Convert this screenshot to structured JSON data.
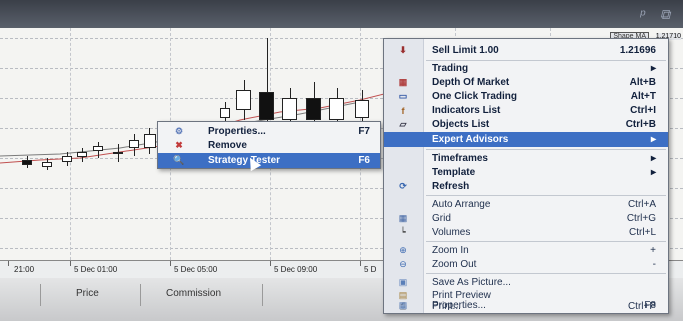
{
  "chart": {
    "ma_label": "Shape MA",
    "price_tag": "1.21710"
  },
  "time_axis": {
    "labels": [
      "21:00",
      "5 Dec 01:00",
      "5 Dec 05:00",
      "5 Dec 09:00",
      "5 D"
    ]
  },
  "terminal": {
    "columns": [
      "Price",
      "Commission"
    ]
  },
  "submenu": {
    "items": [
      {
        "label": "Properties...",
        "shortcut": "F7",
        "icon": "properties-icon"
      },
      {
        "label": "Remove",
        "shortcut": "",
        "icon": "remove-icon"
      },
      {
        "label": "Strategy Tester",
        "shortcut": "F6",
        "icon": "strategy-tester-icon"
      }
    ]
  },
  "main_menu": {
    "items": [
      {
        "label": "Sell Limit 1.00",
        "shortcut": "1.21696",
        "icon": "sell-limit-icon"
      },
      {
        "label": "Trading",
        "shortcut": "▸",
        "icon": ""
      },
      {
        "label": "Depth Of Market",
        "shortcut": "Alt+B",
        "icon": "depth-of-market-icon"
      },
      {
        "label": "One Click Trading",
        "shortcut": "Alt+T",
        "icon": "one-click-trading-icon"
      },
      {
        "label": "Indicators List",
        "shortcut": "Ctrl+I",
        "icon": "indicators-list-icon"
      },
      {
        "label": "Objects List",
        "shortcut": "Ctrl+B",
        "icon": "objects-list-icon"
      },
      {
        "label": "Expert Advisors",
        "shortcut": "▸",
        "icon": ""
      },
      {
        "label": "Timeframes",
        "shortcut": "▸",
        "icon": ""
      },
      {
        "label": "Template",
        "shortcut": "▸",
        "icon": ""
      },
      {
        "label": "Refresh",
        "shortcut": "",
        "icon": "refresh-icon"
      },
      {
        "label": "Auto Arrange",
        "shortcut": "Ctrl+A",
        "icon": ""
      },
      {
        "label": "Grid",
        "shortcut": "Ctrl+G",
        "icon": "grid-icon"
      },
      {
        "label": "Volumes",
        "shortcut": "Ctrl+L",
        "icon": "volumes-icon"
      },
      {
        "label": "Zoom In",
        "shortcut": "+",
        "icon": "zoom-in-icon"
      },
      {
        "label": "Zoom Out",
        "shortcut": "-",
        "icon": "zoom-out-icon"
      },
      {
        "label": "Save As Picture...",
        "shortcut": "",
        "icon": "save-picture-icon"
      },
      {
        "label": "Print Preview",
        "shortcut": "",
        "icon": "print-preview-icon"
      },
      {
        "label": "Print...",
        "shortcut": "Ctrl+P",
        "icon": "print-icon"
      },
      {
        "label": "Properties...",
        "shortcut": "F8",
        "icon": "chart-properties-icon"
      }
    ]
  },
  "colors": {
    "highlight": "#3d6fc4",
    "menu_bg": "#f2f3f5",
    "chart_bg": "#f4f4f2"
  }
}
